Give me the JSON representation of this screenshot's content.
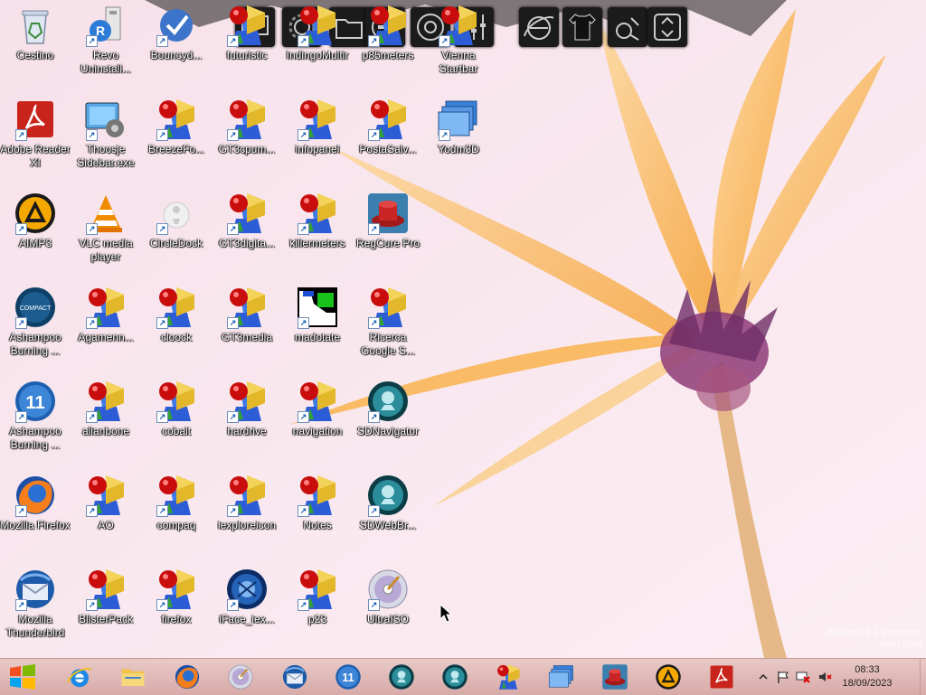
{
  "desktop_icons": [
    {
      "label": "Cestino",
      "type": "recycle"
    },
    {
      "label": "Revo Uninstall...",
      "type": "revo"
    },
    {
      "label": "Bouncyd...",
      "type": "bouncy"
    },
    {
      "label": "futuristic",
      "type": "red-light"
    },
    {
      "label": "IndingoMultir",
      "type": "red-light"
    },
    {
      "label": "p85meters",
      "type": "red-light"
    },
    {
      "label": "Vienna Startbar",
      "type": "red-light"
    },
    {
      "label": "Adobe Reader XI",
      "type": "pdf"
    },
    {
      "label": "Thoosje Sidebar.exe",
      "type": "sidebar"
    },
    {
      "label": "BreezeFo...",
      "type": "red-light"
    },
    {
      "label": "GT3cpum...",
      "type": "red-light"
    },
    {
      "label": "infopanel",
      "type": "red-light"
    },
    {
      "label": "PostaSalv...",
      "type": "red-light"
    },
    {
      "label": "Yodm3D",
      "type": "windows"
    },
    {
      "label": "AIMP3",
      "type": "aimp"
    },
    {
      "label": "VLC media player",
      "type": "vlc"
    },
    {
      "label": "CircleDock",
      "type": "circledock"
    },
    {
      "label": "GT3digita...",
      "type": "red-light"
    },
    {
      "label": "killermeters",
      "type": "red-light"
    },
    {
      "label": "RegCure Pro",
      "type": "regcure"
    },
    {
      "label": "Ashampoo Burning ...",
      "type": "ashampoo-compact"
    },
    {
      "label": "Agamenn...",
      "type": "red-light"
    },
    {
      "label": "cloock",
      "type": "red-light"
    },
    {
      "label": "GT3media",
      "type": "red-light"
    },
    {
      "label": "madotate",
      "type": "madotate"
    },
    {
      "label": "Ricerca Google S...",
      "type": "red-light"
    },
    {
      "label": "Ashampoo Burning ...",
      "type": "ashampoo-11"
    },
    {
      "label": "allanbone",
      "type": "red-light"
    },
    {
      "label": "cobalt",
      "type": "red-light"
    },
    {
      "label": "hardrive",
      "type": "red-light"
    },
    {
      "label": "navigation",
      "type": "red-light"
    },
    {
      "label": "SDNavigator",
      "type": "sd"
    },
    {
      "label": "Mozilla Firefox",
      "type": "firefox"
    },
    {
      "label": "AO",
      "type": "red-light"
    },
    {
      "label": "compaq",
      "type": "red-light"
    },
    {
      "label": "iexploreicon",
      "type": "red-light"
    },
    {
      "label": "Notes",
      "type": "red-light"
    },
    {
      "label": "SDWebBr...",
      "type": "sd"
    },
    {
      "label": "Mozilla Thunderbird",
      "type": "thunderbird"
    },
    {
      "label": "BlisterPack",
      "type": "red-light"
    },
    {
      "label": "firefox",
      "type": "red-light"
    },
    {
      "label": "iFace_iex...",
      "type": "iface"
    },
    {
      "label": "p23",
      "type": "red-light"
    },
    {
      "label": "UltraISO",
      "type": "disc"
    }
  ],
  "dock_items": [
    "monitor",
    "gear",
    "folder",
    "circle-gear",
    "speaker",
    "sliders",
    "ie",
    "tshirt",
    "tools",
    "recycle"
  ],
  "watermark": {
    "line1": "Windows 8.1 Enterprise",
    "line2": "Build 9200"
  },
  "taskbar": {
    "items": [
      "ie",
      "explorer",
      "firefox",
      "disc",
      "thunderbird",
      "ashampoo-11",
      "sd",
      "sd",
      "red-light",
      "windows",
      "regcure",
      "aimp",
      "pdf"
    ]
  },
  "tray": {
    "time": "08:33",
    "date": "18/09/2023"
  },
  "colors": {
    "taskbar": "#dcb0ae",
    "accent_red": "#c8241c",
    "desktop_bg": "#f4dbe6"
  }
}
